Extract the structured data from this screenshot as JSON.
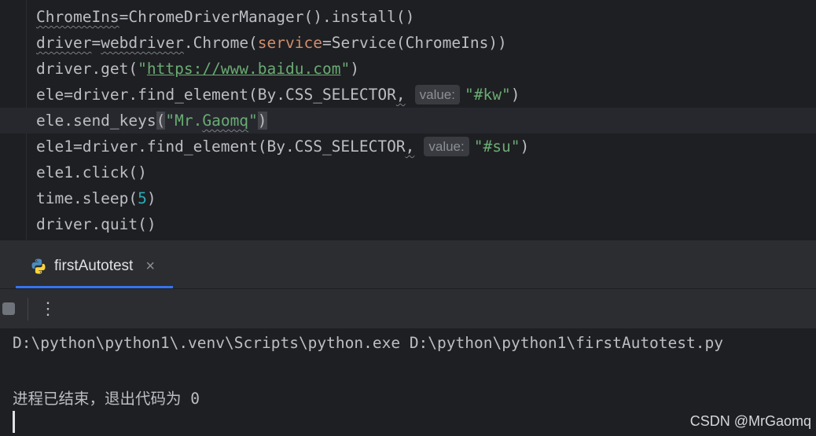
{
  "editor": {
    "lines": [
      {
        "parts": [
          "ChromeIns",
          "=",
          "ChromeDriverManager().install()"
        ]
      },
      {
        "parts": [
          "driver",
          "=",
          "webdriver",
          ".Chrome(",
          "service",
          "=Service(ChromeIns))"
        ]
      },
      {
        "parts": [
          "driver.get(",
          "\"",
          "https://www.baidu.com",
          "\"",
          ")"
        ]
      },
      {
        "parts": [
          "ele=driver.find_element(By.CSS_SELECTOR",
          ",",
          "value:",
          "\"#kw\"",
          ")"
        ]
      },
      {
        "parts": [
          "ele.send_keys",
          "(",
          "\"Mr.",
          "Gaomq",
          "\"",
          ")"
        ]
      },
      {
        "parts": [
          "ele1=driver.find_element(By.CSS_SELECTOR",
          ",",
          "value:",
          "\"#su\"",
          ")"
        ]
      },
      {
        "parts": [
          "ele1.click()"
        ]
      },
      {
        "parts": [
          "time.sleep(",
          "5",
          ")"
        ]
      },
      {
        "parts": [
          "driver.quit()"
        ]
      }
    ]
  },
  "run_panel": {
    "tab_label": "firstAutotest",
    "tab_close": "×",
    "more_label": "⋮",
    "stop_icon": "stop-icon",
    "console": {
      "command": "D:\\python\\python1\\.venv\\Scripts\\python.exe D:\\python\\python1\\firstAutotest.py",
      "exit_message": "进程已结束，退出代码为 0"
    }
  },
  "watermark": "CSDN @MrGaomq",
  "colors": {
    "editor_bg": "#1e1f22",
    "panel_bg": "#2b2d30",
    "text": "#bcbec4",
    "keyword_param": "#cf8e6d",
    "string": "#6aab73",
    "number": "#2aacb8",
    "accent": "#3574f0"
  }
}
